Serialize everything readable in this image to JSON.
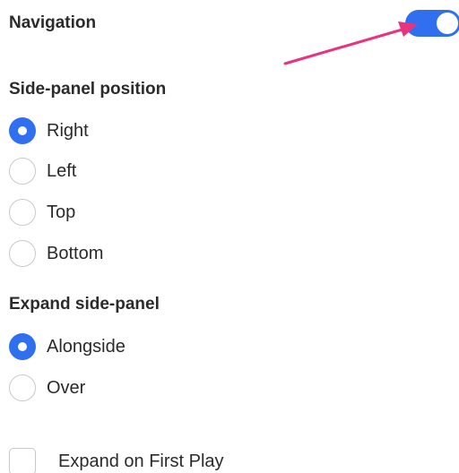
{
  "navigation": {
    "label": "Navigation",
    "toggle_on": true
  },
  "side_panel_position": {
    "title": "Side-panel position",
    "options": [
      {
        "label": "Right",
        "checked": true
      },
      {
        "label": "Left",
        "checked": false
      },
      {
        "label": "Top",
        "checked": false
      },
      {
        "label": "Bottom",
        "checked": false
      }
    ]
  },
  "expand_side_panel": {
    "title": "Expand side-panel",
    "options": [
      {
        "label": "Alongside",
        "checked": true
      },
      {
        "label": "Over",
        "checked": false
      }
    ]
  },
  "expand_on_first_play": {
    "label": "Expand on First Play",
    "checked": false
  },
  "colors": {
    "accent": "#3070f0",
    "arrow": "#e8337f",
    "text": "#2a2a2a",
    "border": "#c9c9c9"
  },
  "annotation": {
    "icon": "pointer-arrow-icon"
  }
}
